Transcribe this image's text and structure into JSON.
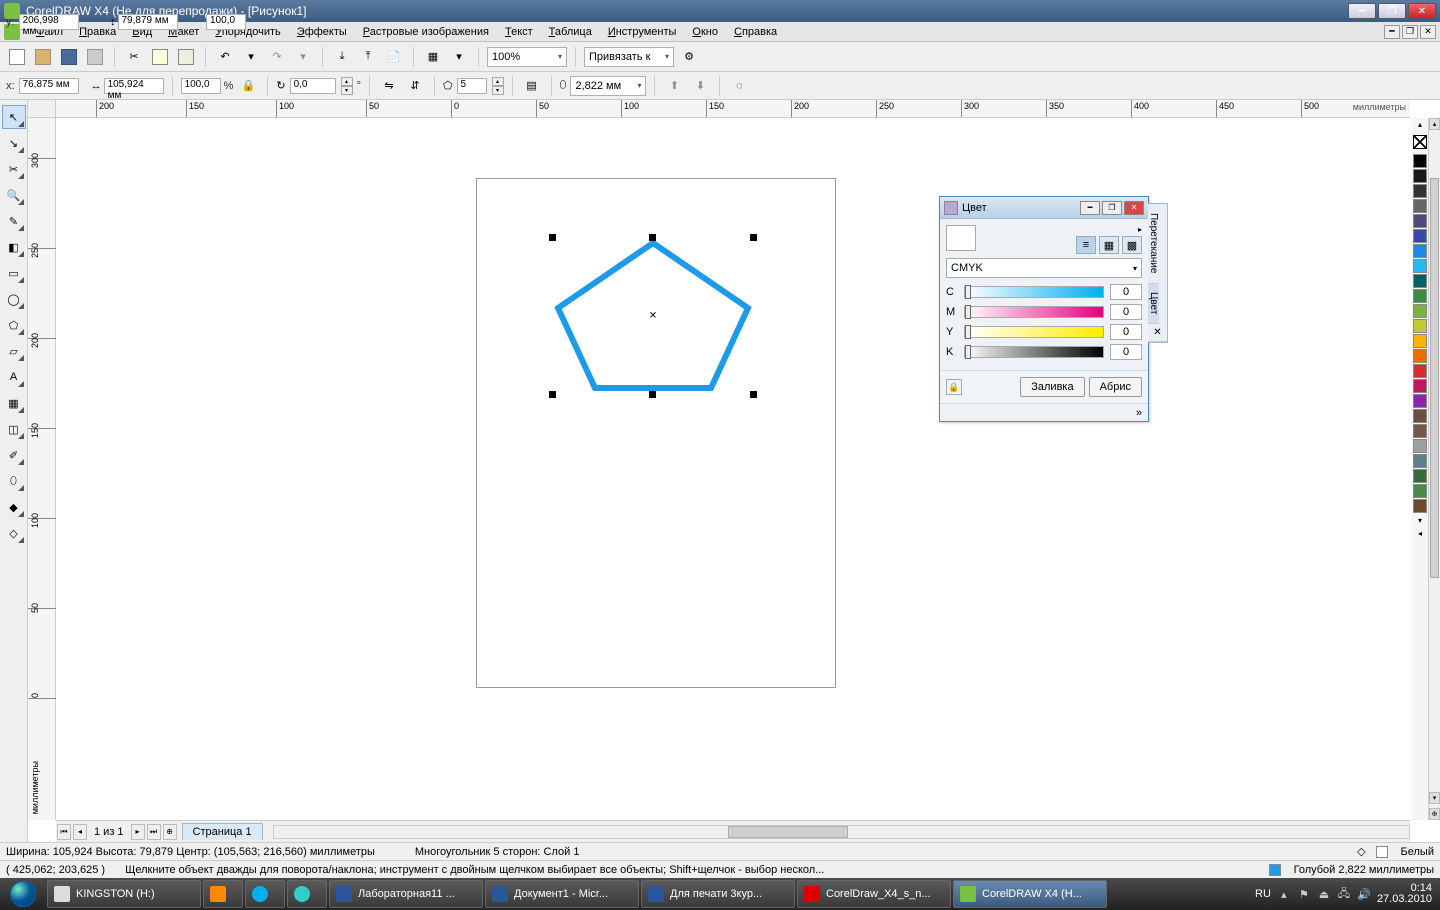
{
  "title": "CorelDRAW X4 (Не для перепродажи) - [Рисунок1]",
  "menu": [
    "Файл",
    "Правка",
    "Вид",
    "Макет",
    "Упорядочить",
    "Эффекты",
    "Растровые изображения",
    "Текст",
    "Таблица",
    "Инструменты",
    "Окно",
    "Справка"
  ],
  "toolbar": {
    "zoom": "100%",
    "snap_label": "Привязать к"
  },
  "propbar": {
    "x_label": "x:",
    "x": "76,875 мм",
    "y_label": "y:",
    "y": "206,998 мм",
    "width": "105,924 мм",
    "height": "79,879 мм",
    "scale_x": "100,0",
    "scale_y": "100,0",
    "pct": "%",
    "rotation": "0,0",
    "deg": "°",
    "sides": "5",
    "outline": "2,822 мм"
  },
  "ruler": {
    "unit": "миллиметры",
    "h_ticks": [
      "200",
      "150",
      "100",
      "50",
      "0",
      "50",
      "100",
      "150",
      "200",
      "250",
      "300",
      "350",
      "400",
      "450",
      "500"
    ],
    "v_ticks": [
      "300",
      "250",
      "200",
      "150",
      "100",
      "50",
      "0"
    ],
    "v_unit_label": "миллиметры"
  },
  "pagetabs": {
    "page_of": "1 из 1",
    "page1": "Страница 1"
  },
  "docker": {
    "title": "Цвет",
    "model": "CMYK",
    "labels": {
      "c": "C",
      "m": "M",
      "y": "Y",
      "k": "K"
    },
    "c": "0",
    "m": "0",
    "y": "0",
    "k": "0",
    "fill_btn": "Заливка",
    "outline_btn": "Абрис",
    "sidetab1": "Перетекание",
    "sidetab2": "Цвет"
  },
  "palette_colors": [
    "#000000",
    "#1a1a1a",
    "#333333",
    "#666666",
    "#504a7a",
    "#3949ab",
    "#1e88e5",
    "#29b6f6",
    "#006064",
    "#388e3c",
    "#7cb342",
    "#c0ca33",
    "#ffb300",
    "#ef6c00",
    "#d32f2f",
    "#c2185b",
    "#8e24aa",
    "#6d4c41",
    "#795548",
    "#9e9e9e",
    "#607d8b",
    "#3a6a3a",
    "#4a8a4a",
    "#6a4a2a"
  ],
  "status1": {
    "dims": "Ширина: 105,924 Высота: 79,879 Центр: (105,563; 216,560) миллиметры",
    "shape": "Многоугольник  5 сторон: Слой 1",
    "fill_label": "Белый"
  },
  "status2": {
    "coords": "( 425,062; 203,625 )",
    "hint": "Щелкните объект дважды для поворота/наклона; инструмент с двойным щелчком выбирает все объекты; Shift+щелчок - выбор нескол...",
    "outline_label": "Голубой  2,822 миллиметры"
  },
  "taskbar": {
    "kingston": "KINGSTON (H:)",
    "doc1": "Лабораторная11 ...",
    "doc2": "Документ1 - Micr...",
    "doc3": "Для печати 3кур...",
    "pdf": "CorelDraw_X4_s_n...",
    "corel": "CorelDRAW X4 (Н...",
    "lang": "RU",
    "time": "0:14",
    "date": "27.03.2010"
  }
}
